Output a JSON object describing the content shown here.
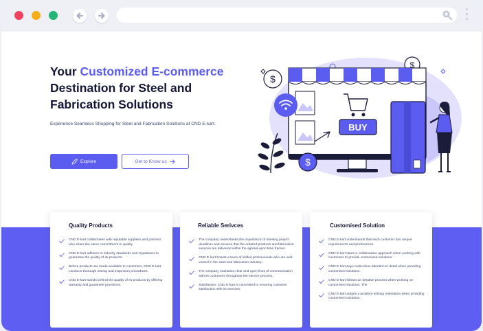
{
  "browser": {
    "traffic_lights": [
      "#ef4461",
      "#f5ad1c",
      "#22b573"
    ],
    "icons": [
      "back-arrow-icon",
      "forward-arrow-icon",
      "search-icon",
      "kebab-menu-icon"
    ]
  },
  "hero": {
    "title_part1": "Your ",
    "title_highlight": "Customized E-commerce",
    "title_part2": " Destination for Steel and Fabrication Solutions",
    "subtitle": "Experience Seamless Shopping for Steel and Fabrication Solutions at CND E-kart.",
    "explore_label": "Explore",
    "know_label": "Get to Know us",
    "buy_label": "BUY",
    "accent": "#5b5cf0"
  },
  "cards": [
    {
      "title": "Quality Products",
      "items": [
        "CND E-kart collaborates with reputable suppliers and partners who share the same commitment to quality.",
        "CND E-kart adheres to industry standards and regulations to guarantee the quality of its products.",
        "Before products are made available to customers, CND E-kart conducts thorough testing and inspection procedures.",
        "CND E-kart stands behind the quality of its products by offering warranty and guarantee provisions."
      ]
    },
    {
      "title": "Reliable Serivces",
      "items": [
        "The company understands the importance of meeting project deadlines and ensures that the ordered products and fabrication services are delivered within the agreed-upon time frames.",
        "CND E-kart boasts a team of skilled professionals who are well-versed in the steel and fabrication industry.",
        "The company maintains clear and open lines of communication with its customers throughout the service process.",
        "Satisfaction: CND E-kart is committed to ensuring customer satisfaction with its services."
      ]
    },
    {
      "title": "Customised Solution",
      "items": [
        "CND E-kart understands that each customer has unique requirements and preferences.",
        "CND E-kart takes a collaborative approach when working with customers to provide customised solutions.",
        "CND E-kart pays meticulous attention to detail when providing customised solutions.",
        "CND E-kart follows an iterative process when working on customised solutions. The",
        "CND E-kart adopts a problem-solving orientation when providing customised solutions."
      ]
    }
  ]
}
